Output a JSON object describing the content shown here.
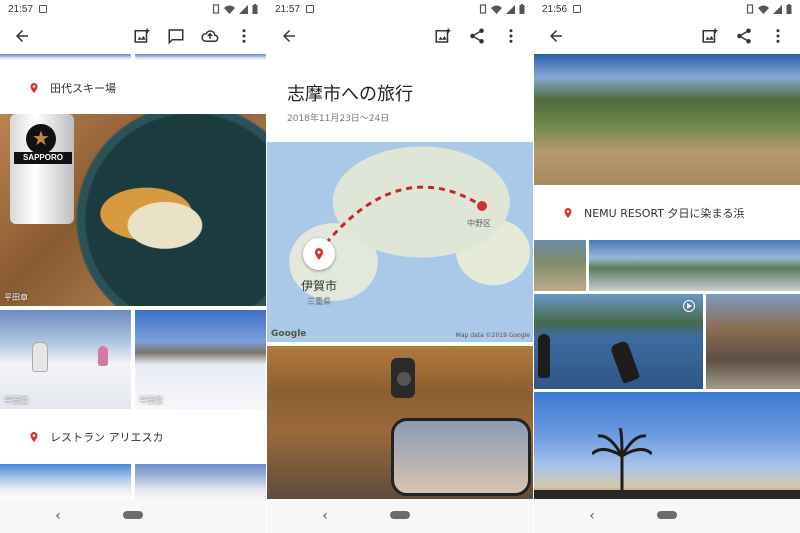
{
  "colors": {
    "accent_red": "#d93025",
    "icon_gray": "#555555",
    "bg": "#ffffff"
  },
  "panel1": {
    "status_time": "21:57",
    "toolbar_icons": [
      "back-arrow-icon",
      "add-photo-icon",
      "comment-icon",
      "cloud-upload-icon",
      "more-vert-icon"
    ],
    "locations": [
      {
        "label": "田代スキー場"
      },
      {
        "label": "レストラン アリエスカ"
      }
    ],
    "photos": [
      {
        "author": "平田章"
      },
      {
        "author": "平田章"
      },
      {
        "author": "平田章"
      }
    ],
    "bottle_label": "SAPPORO"
  },
  "panel2": {
    "status_time": "21:57",
    "toolbar_icons": [
      "back-arrow-icon",
      "add-photo-icon",
      "share-icon",
      "more-vert-icon"
    ],
    "title": "志摩市への旅行",
    "date_range": "2018年11月23日～24日",
    "map": {
      "start_city": "伊賀市",
      "start_pref": "三重県",
      "end_label": "中野区",
      "google_logo": "Google",
      "credit": "Map data ©2019 Google"
    }
  },
  "panel3": {
    "status_time": "21:56",
    "toolbar_icons": [
      "back-arrow-icon",
      "add-photo-icon",
      "share-icon",
      "more-vert-icon"
    ],
    "location": {
      "label": "NEMU RESORT 夕日に染まる浜"
    }
  },
  "nav": {
    "back_glyph": "‹"
  }
}
